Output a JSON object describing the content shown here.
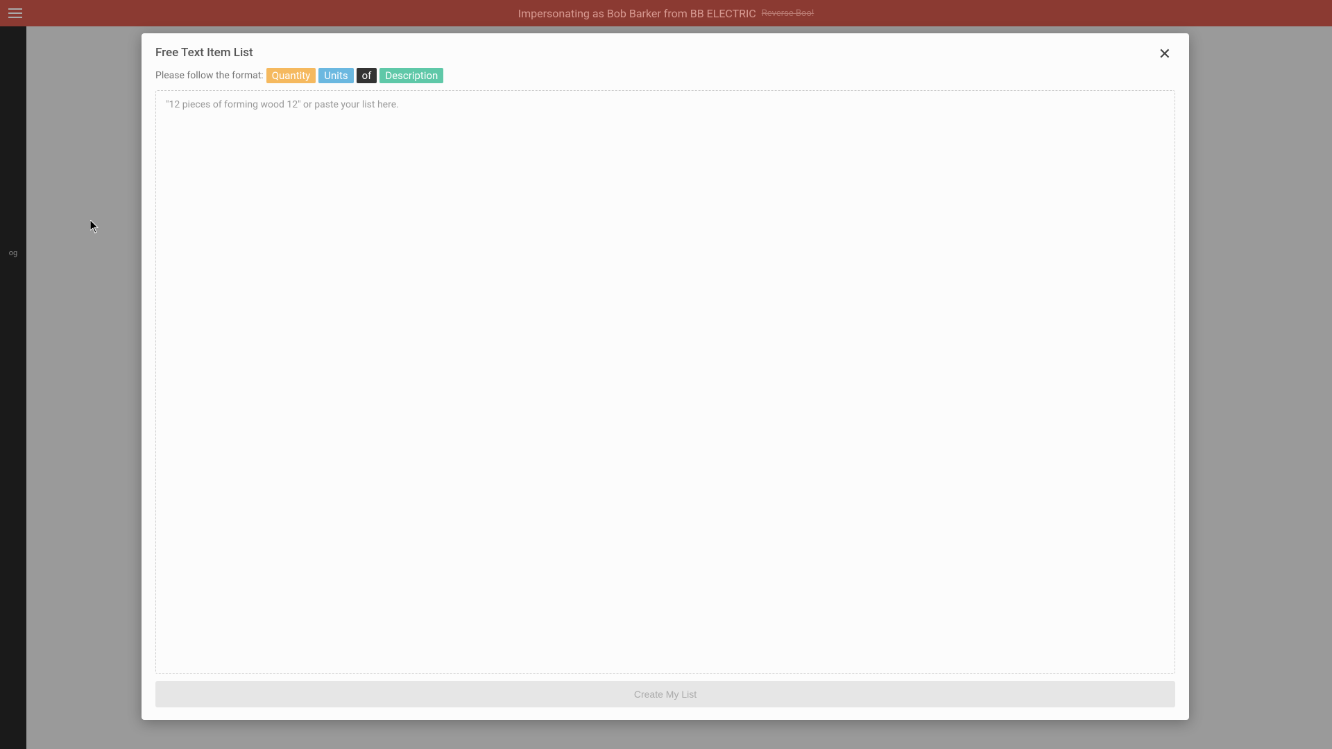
{
  "topbar": {
    "impersonating_text": "Impersonating as Bob Barker from BB ELECTRIC",
    "reverse_text": "Reverse Boo!"
  },
  "sidebar": {
    "item_label": "og"
  },
  "modal": {
    "title": "Free Text Item List",
    "format_prefix": "Please follow the format:",
    "tags": {
      "quantity": "Quantity",
      "units": "Units",
      "of": "of",
      "description": "Description"
    },
    "textarea_placeholder": "\"12 pieces of forming wood 12\" or paste your list here.",
    "submit_label": "Create My List"
  }
}
